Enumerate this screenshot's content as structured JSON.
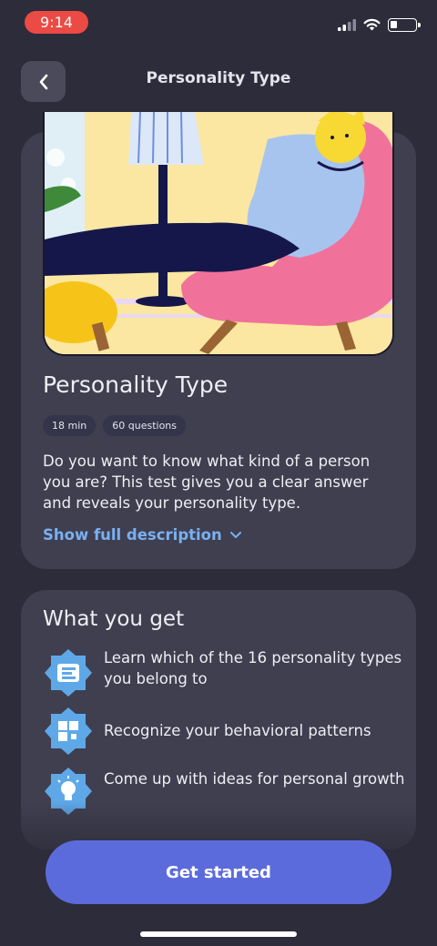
{
  "status_bar": {
    "time": "9:14"
  },
  "nav": {
    "title": "Personality Type"
  },
  "test": {
    "title": "Personality Type",
    "tags": [
      "18 min",
      "60 questions"
    ],
    "description": "Do you want to know what kind of a person you are? This test gives you a clear answer and reveals your personality type.",
    "show_more_label": "Show full description"
  },
  "benefits": {
    "title": "What you get",
    "items": [
      {
        "icon": "list-icon",
        "text": "Learn which of the 16 personality types you belong to"
      },
      {
        "icon": "puzzle-icon",
        "text": "Recognize your behavioral patterns"
      },
      {
        "icon": "lightbulb-icon",
        "text": "Come up with ideas for personal growth"
      }
    ]
  },
  "cta": {
    "label": "Get started"
  },
  "colors": {
    "background": "#2c2c3a",
    "card": "#3f3f50",
    "accent": "#5c6bdc",
    "link": "#7ab0f0",
    "badge": "#5ea8e8"
  }
}
